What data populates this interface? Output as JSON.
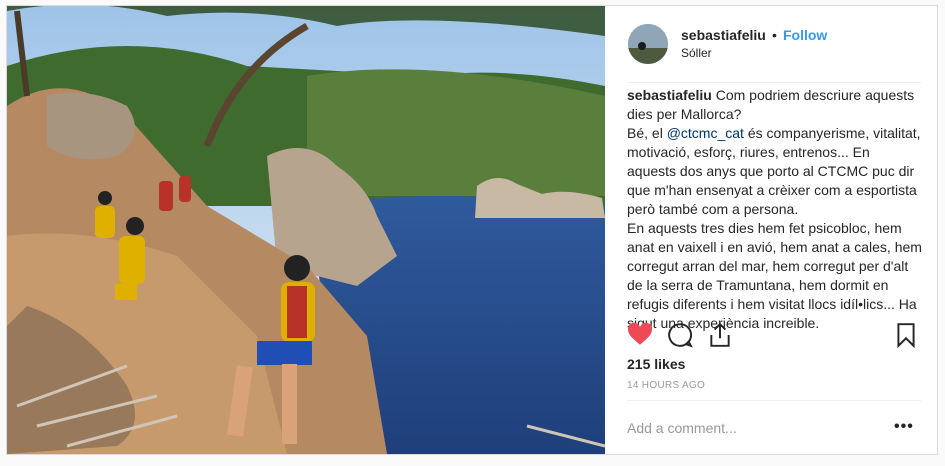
{
  "post": {
    "username": "sebastiafeliu",
    "separator": "•",
    "follow_label": "Follow",
    "location": "Sóller",
    "caption_user": "sebastiafeliu",
    "caption_parts": [
      "Com podriem descriure aquests dies per Mallorca?\nBé, el ",
      "@ctcmc_cat",
      " és companyerisme, vitalitat, motivació, esforç, riures, entrenos... En aquests dos anys que porto al CTCMC puc dir que m'han ensenyat a crèixer com a esportista però també com a persona.\nEn aquests tres dies hem fet psicobloc, hem anat en vaixell i en avió, hem anat a cales, hem corregut arran del mar, hem corregut per d'alt de la serra de Tramuntana, hem dormit en refugis diferents i hem visitat llocs idíl•lics... Ha sigut una experiència increible."
    ],
    "likes": "215 likes",
    "timestamp": "14 HOURS AGO",
    "comment_placeholder": "Add a comment...",
    "more_label": "•••"
  },
  "icons": [
    "heart-icon",
    "comment-icon",
    "share-icon",
    "bookmark-icon"
  ],
  "colors": {
    "like": "#ed4956",
    "follow": "#3897f0",
    "mention": "#003569"
  }
}
